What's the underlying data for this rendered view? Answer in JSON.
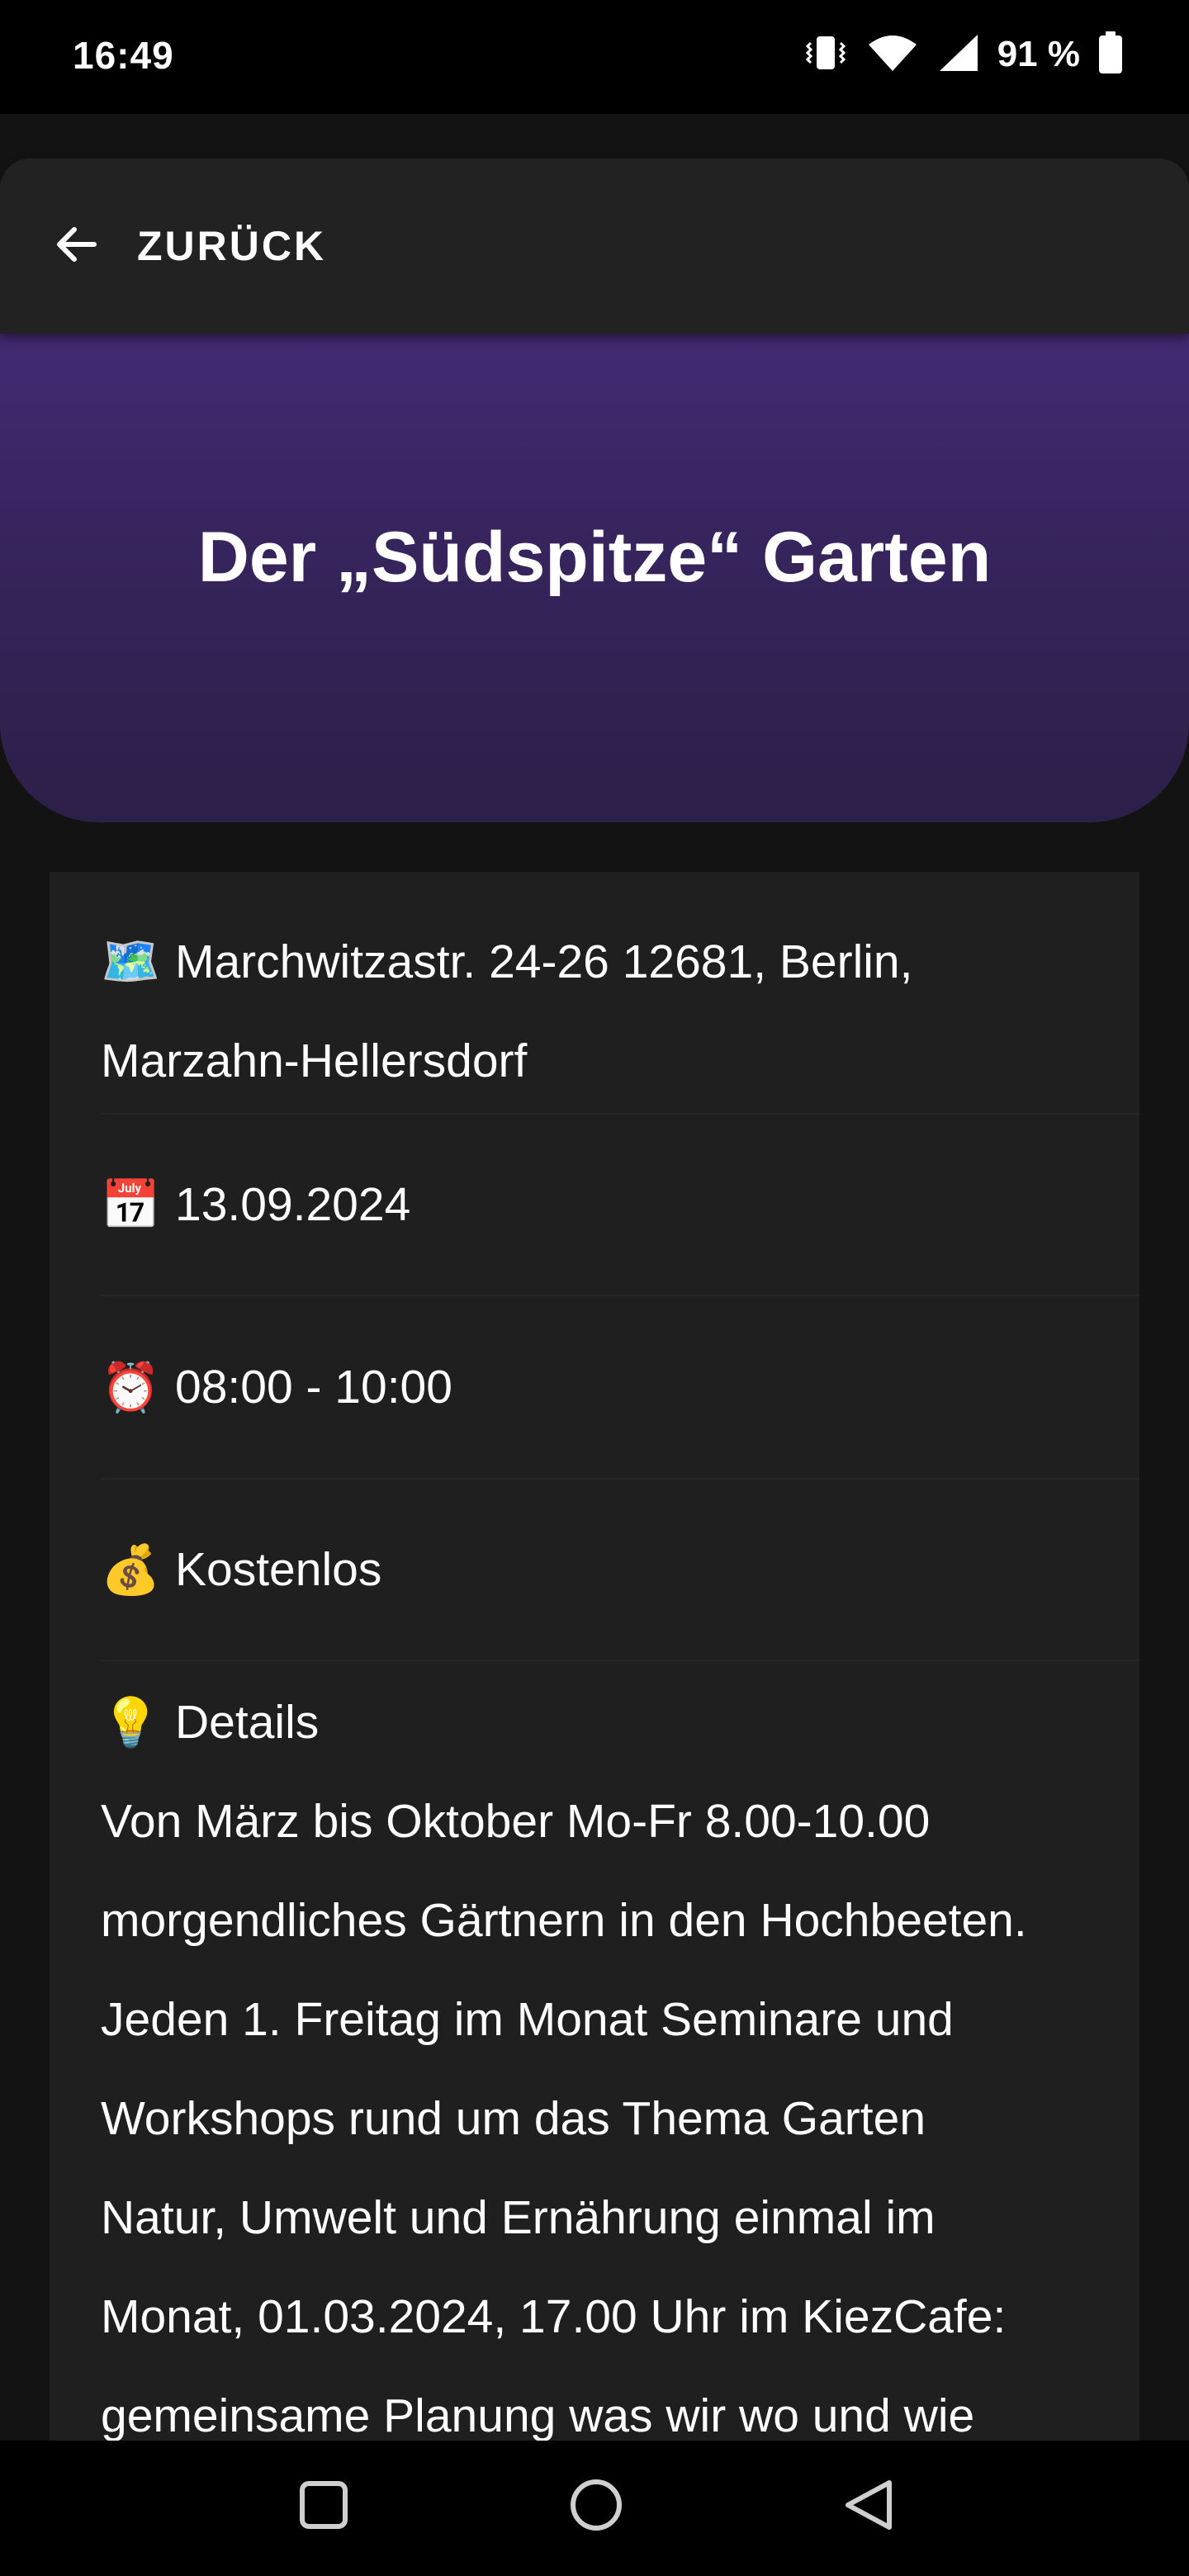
{
  "status_bar": {
    "time": "16:49",
    "battery_percent": "91 %",
    "icons": [
      "vibrate-icon",
      "wifi-icon",
      "signal-icon",
      "battery-icon"
    ]
  },
  "header": {
    "back_label": "ZURÜCK",
    "back_icon": "arrow-left-icon"
  },
  "hero": {
    "title": "Der „Südspitze“ Garten",
    "gradient": [
      "#432a72",
      "#2c1f48"
    ]
  },
  "info": {
    "address": {
      "icon": "🗺️",
      "line1": "Marchwitzastr. 24-26 12681, Berlin,",
      "line2": "Marzahn-Hellersdorf"
    },
    "date": {
      "icon": "📅",
      "text": "13.09.2024"
    },
    "time": {
      "icon": "⏰",
      "text": "08:00 - 10:00"
    },
    "price": {
      "icon": "💰",
      "text": "Kostenlos"
    },
    "details": {
      "icon": "💡",
      "title": "Details",
      "lines": [
        "Von März bis Oktober Mo-Fr 8.00-10.00",
        "morgendliches Gärtnern in den Hochbeeten.",
        "Jeden 1. Freitag im Monat Seminare und",
        "Workshops rund um das Thema Garten",
        "Natur, Umwelt und Ernährung einmal im",
        "Monat, 01.03.2024, 17.00 Uhr im KiezCafe:",
        "gemeinsame Planung was wir wo und wie"
      ]
    }
  },
  "nav": {
    "buttons": [
      "recents-icon",
      "home-icon",
      "back-triangle-icon"
    ]
  }
}
